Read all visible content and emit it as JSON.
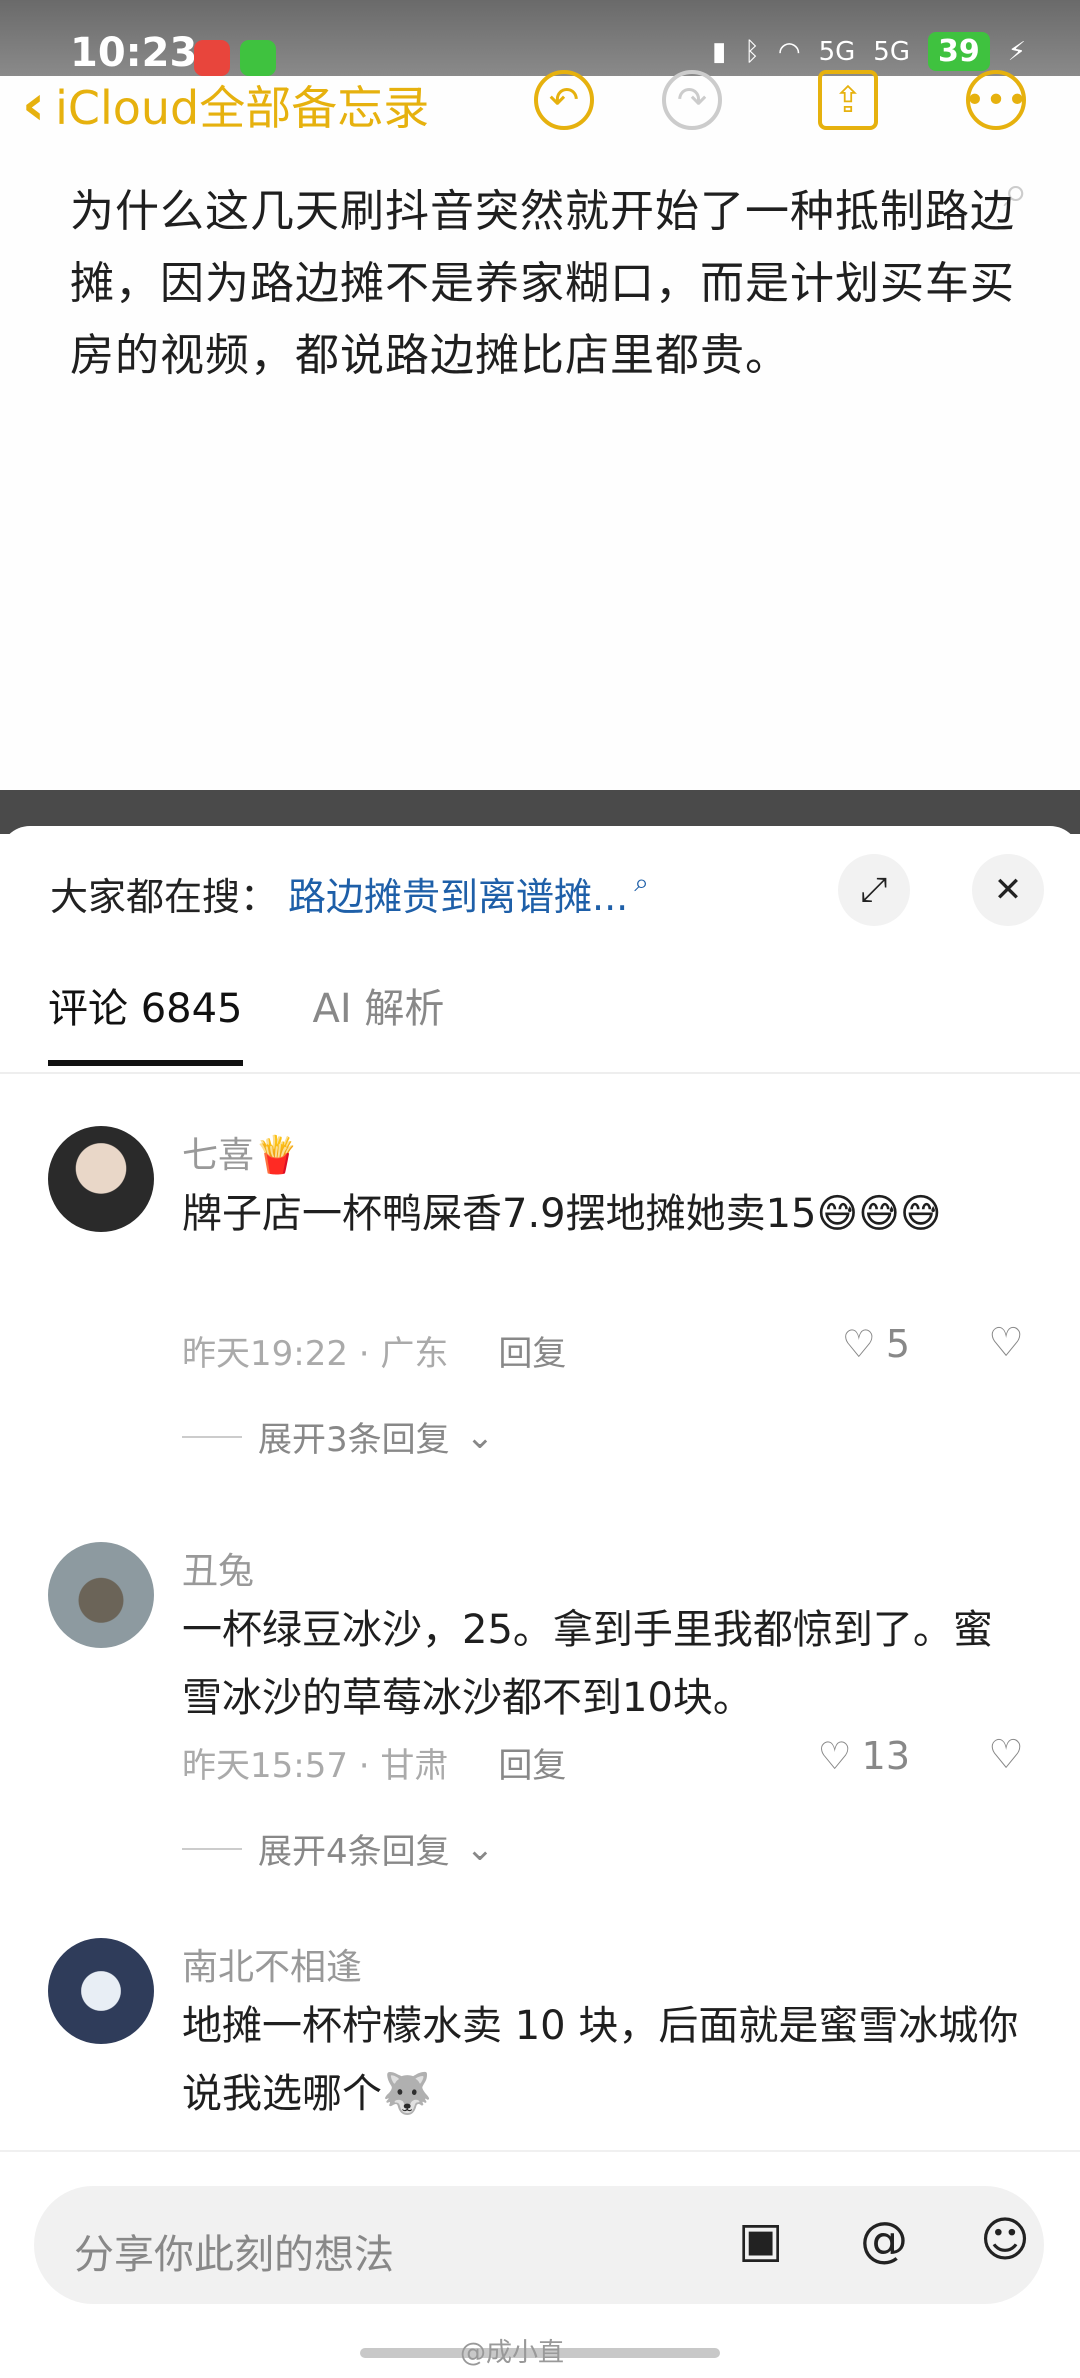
{
  "status_bar": {
    "time": "10:23",
    "battery": "39",
    "net_1": "5G",
    "net_2": "5G"
  },
  "notes": {
    "back_label": "iCloud全部备忘录",
    "body": "为什么这几天刷抖音突然就开始了一种抵制路边摊，因为路边摊不是养家糊口，而是计划买车买房的视频，都说路边摊比店里都贵。"
  },
  "sheet": {
    "search_hint_label": "大家都在搜：",
    "search_hint_link": "路边摊贵到离谱摊...",
    "tabs": [
      {
        "label": "评论 6845"
      },
      {
        "label": "AI 解析"
      }
    ]
  },
  "comments": [
    {
      "name": "七喜🍟",
      "text": "牌子店一杯鸭屎香7.9摆地摊她卖15😅😅😅",
      "time": "昨天19:22 · 广东",
      "reply": "回复",
      "likes": "5",
      "expand": "展开3条回复"
    },
    {
      "name": "丑兔",
      "text": "一杯绿豆冰沙，25。拿到手里我都惊到了。蜜雪冰沙的草莓冰沙都不到10块。",
      "time": "昨天15:57 · 甘肃",
      "reply": "回复",
      "likes": "13",
      "expand": "展开4条回复"
    },
    {
      "name": "南北不相逢",
      "text": "地摊一杯柠檬水卖 10 块，后面就是蜜雪冰城你说我选哪个🐺"
    }
  ],
  "bottom": {
    "placeholder": "分享你此刻的想法",
    "watermark": "@成小直"
  },
  "colors": {
    "accent_yellow": "#e6b10e",
    "link_blue": "#1e5fa8"
  }
}
